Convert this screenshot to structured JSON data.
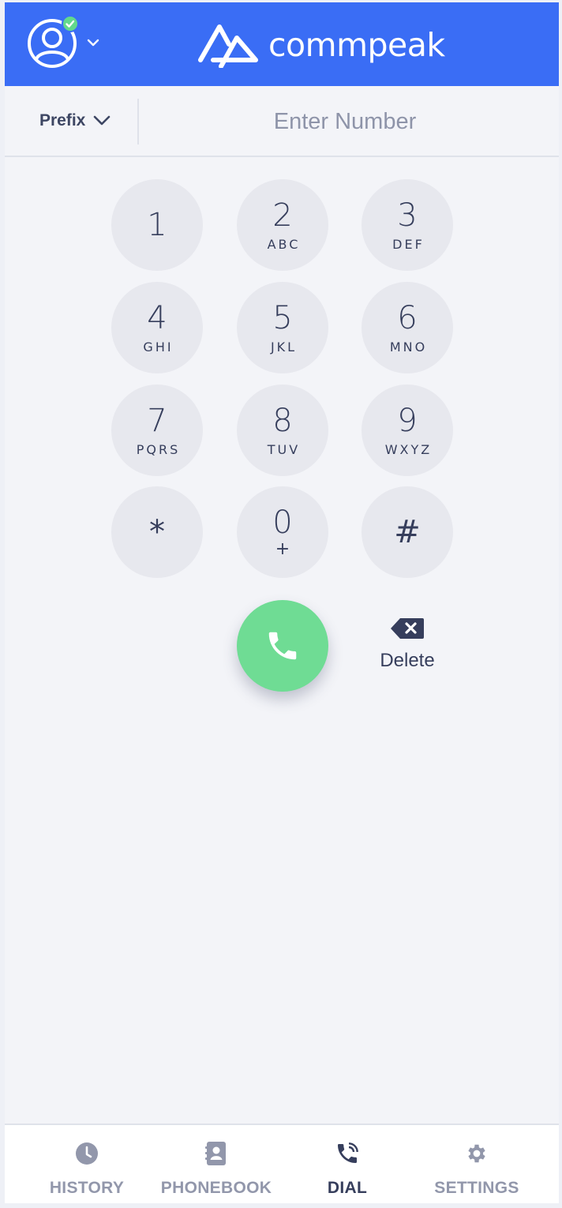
{
  "header": {
    "brand": "commpeak",
    "colors": {
      "header_bg": "#3a6df5",
      "status_online": "#62d98c"
    }
  },
  "entry": {
    "prefix_label": "Prefix",
    "number_placeholder": "Enter Number",
    "number_value": ""
  },
  "keypad": {
    "keys": [
      {
        "digit": "1",
        "letters": ""
      },
      {
        "digit": "2",
        "letters": "ABC"
      },
      {
        "digit": "3",
        "letters": "DEF"
      },
      {
        "digit": "4",
        "letters": "GHI"
      },
      {
        "digit": "5",
        "letters": "JKL"
      },
      {
        "digit": "6",
        "letters": "MNO"
      },
      {
        "digit": "7",
        "letters": "PQRS"
      },
      {
        "digit": "8",
        "letters": "TUV"
      },
      {
        "digit": "9",
        "letters": "WXYZ"
      },
      {
        "digit": "*",
        "letters": ""
      },
      {
        "digit": "0",
        "letters": "+"
      },
      {
        "digit": "#",
        "letters": ""
      }
    ],
    "call_color": "#6fdc94",
    "delete_label": "Delete"
  },
  "nav": {
    "items": [
      {
        "label": "HISTORY",
        "icon": "clock-icon",
        "active": false
      },
      {
        "label": "PHONEBOOK",
        "icon": "contact-book-icon",
        "active": false
      },
      {
        "label": "DIAL",
        "icon": "phone-ringing-icon",
        "active": true
      },
      {
        "label": "SETTINGS",
        "icon": "gear-icon",
        "active": false
      }
    ]
  }
}
